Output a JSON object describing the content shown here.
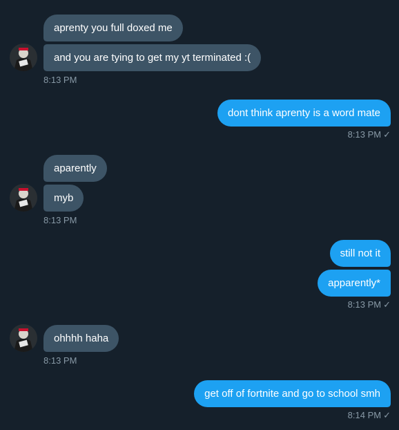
{
  "colors": {
    "background": "#15202b",
    "incoming_bubble": "#3d5466",
    "outgoing_bubble": "#1da1f2",
    "timestamp": "#8899a6"
  },
  "messages": {
    "g1": {
      "m1": "aprenty you full doxed me",
      "m2": "and you are tying to get my yt terminated :(",
      "time": "8:13 PM"
    },
    "g2": {
      "m1": "dont think aprenty is a word mate",
      "time": "8:13 PM",
      "status_icon": "check-icon"
    },
    "g3": {
      "m1": "aparently",
      "m2": "myb",
      "time": "8:13 PM"
    },
    "g4": {
      "m1": "still not it",
      "m2": "apparently*",
      "time": "8:13 PM",
      "status_icon": "check-icon"
    },
    "g5": {
      "m1": "ohhhh haha",
      "time": "8:13 PM"
    },
    "g6": {
      "m1": "get off of fortnite and go to school smh",
      "time": "8:14 PM",
      "status_icon": "check-icon"
    }
  },
  "check_glyph": "✓"
}
